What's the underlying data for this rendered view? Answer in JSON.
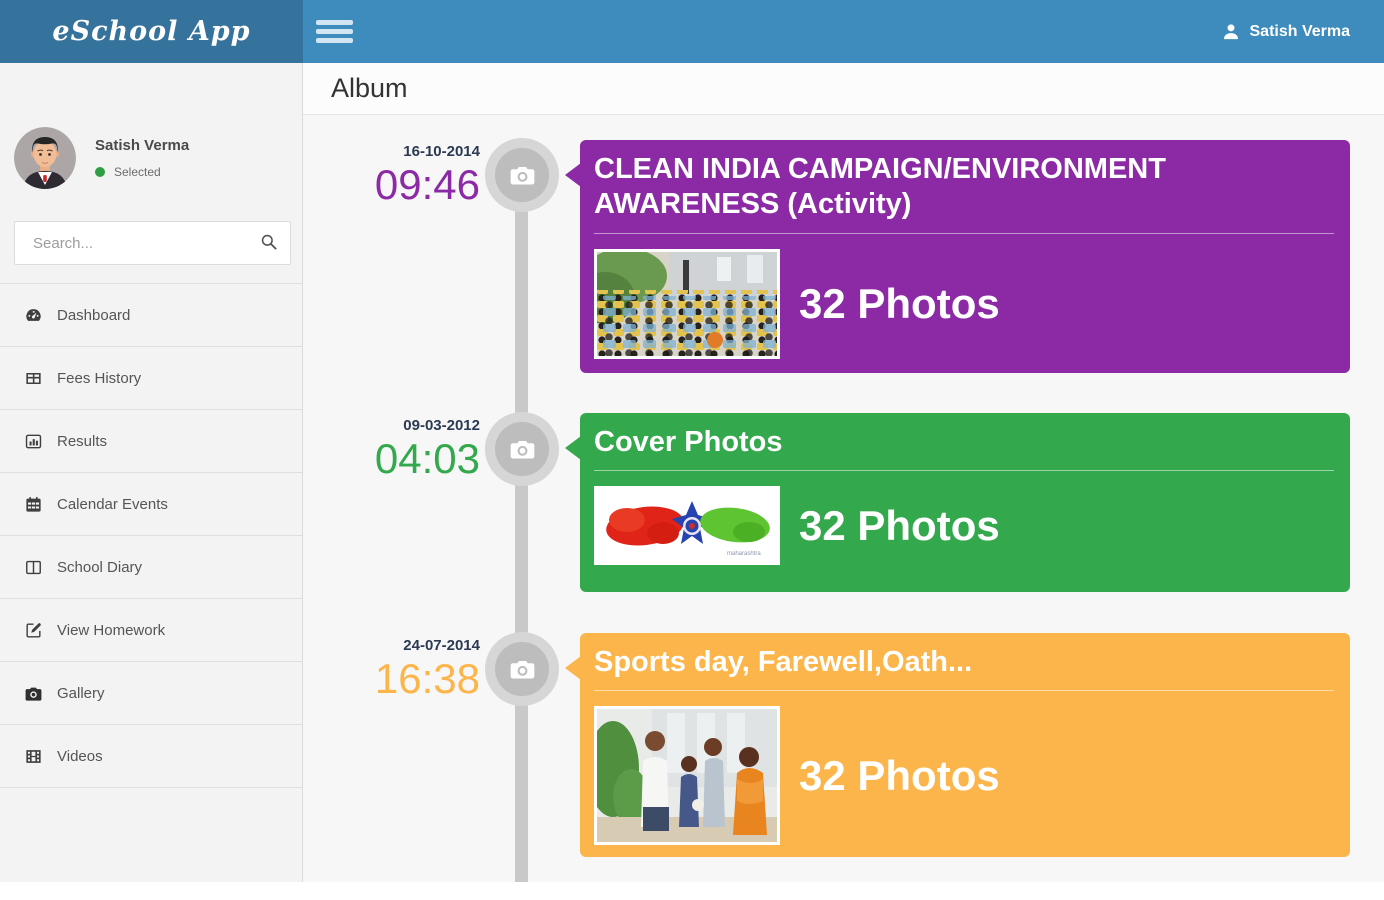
{
  "header": {
    "app_name": "eSchool App",
    "user_name": "Satish Verma",
    "menu_icon": "hamburger-icon",
    "user_icon": "person-icon"
  },
  "sidebar": {
    "user": {
      "name": "Satish Verma",
      "status": "Selected",
      "status_color": "#2E9E44"
    },
    "search": {
      "placeholder": "Search...",
      "icon": "magnifier-icon"
    },
    "items": [
      {
        "label": "Dashboard",
        "icon": "dashboard-icon"
      },
      {
        "label": "Fees History",
        "icon": "table-icon"
      },
      {
        "label": "Results",
        "icon": "chart-icon"
      },
      {
        "label": "Calendar Events",
        "icon": "calendar-icon"
      },
      {
        "label": "School Diary",
        "icon": "book-icon"
      },
      {
        "label": "View Homework",
        "icon": "pencil-icon"
      },
      {
        "label": "Gallery",
        "icon": "camera-icon"
      },
      {
        "label": "Videos",
        "icon": "film-icon"
      }
    ]
  },
  "main": {
    "title": "Album",
    "timeline_icon": "camera-icon",
    "albums": [
      {
        "date": "16-10-2014",
        "time": "09:46",
        "title": "CLEAN INDIA CAMPAIGN/ENVIRONMENT AWARENESS (Activity)",
        "photos_label": "32 Photos",
        "color": "#8B2AA4",
        "thumbnail": "crowd-photo"
      },
      {
        "date": "09-03-2012",
        "time": "04:03",
        "title": "Cover Photos",
        "photos_label": "32 Photos",
        "color": "#34A84C",
        "thumbnail": "map-artwork-photo"
      },
      {
        "date": "24-07-2014",
        "time": "16:38",
        "title": "Sports day, Farewell,Oath...",
        "photos_label": "32 Photos",
        "color": "#FCB54A",
        "thumbnail": "ceremony-photo"
      }
    ]
  },
  "theme": {
    "header_left_bg": "#36739C",
    "header_right_bg": "#3E8CBD",
    "sidebar_bg": "#F3F3F3",
    "content_bg": "#F7F7F7",
    "timeline_color": "#C9C9C9"
  }
}
